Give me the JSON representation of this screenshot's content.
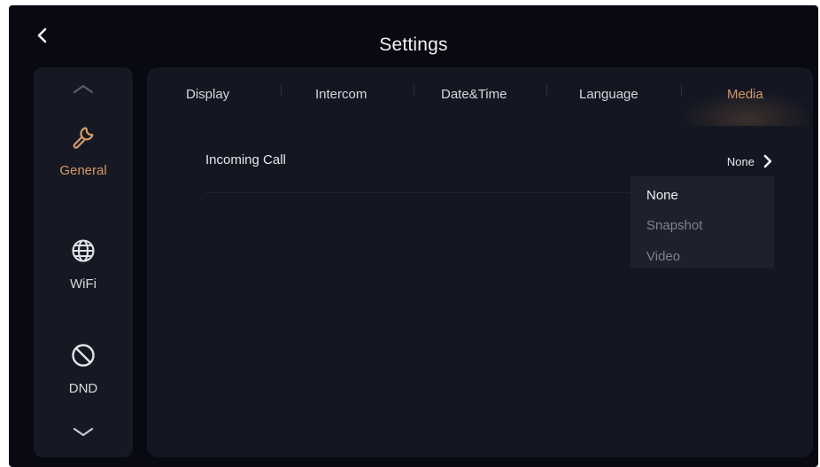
{
  "header": {
    "title": "Settings"
  },
  "sidebar": {
    "items": [
      {
        "label": "General",
        "icon": "wrench-icon",
        "active": true
      },
      {
        "label": "WiFi",
        "icon": "globe-icon",
        "active": false
      },
      {
        "label": "DND",
        "icon": "do-not-disturb-icon",
        "active": false
      }
    ]
  },
  "tabs": [
    {
      "label": "Display",
      "active": false
    },
    {
      "label": "Intercom",
      "active": false
    },
    {
      "label": "Date&Time",
      "active": false
    },
    {
      "label": "Language",
      "active": false
    },
    {
      "label": "Media",
      "active": true
    }
  ],
  "settings": {
    "incoming_call": {
      "label": "Incoming Call",
      "value": "None"
    }
  },
  "dropdown": {
    "options": [
      "None",
      "Snapshot",
      "Video"
    ],
    "selected": "None"
  },
  "colors": {
    "accent": "#d59a67",
    "background": "#090a11",
    "panel": "#141722",
    "sidebar": "#161923"
  }
}
